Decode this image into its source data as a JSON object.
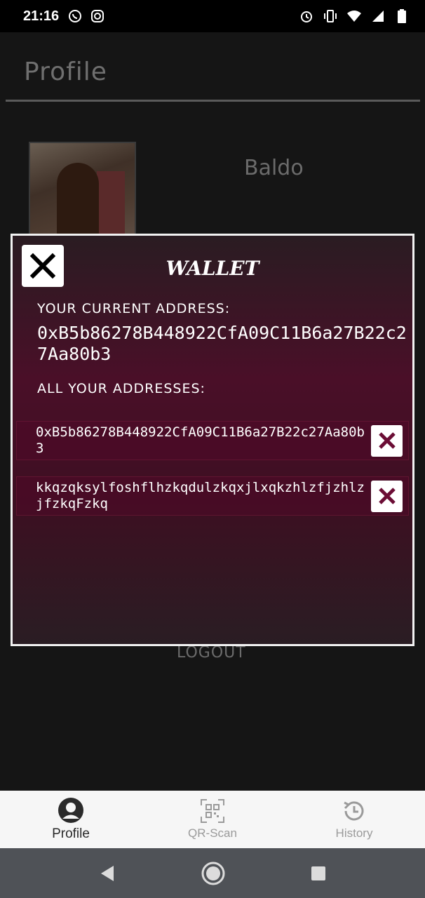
{
  "status_bar": {
    "time": "21:16",
    "left_icons": [
      "whatsapp-icon",
      "instagram-icon"
    ],
    "right_icons": [
      "alarm-icon",
      "vibrate-icon",
      "wifi-icon",
      "signal-icon",
      "battery-icon"
    ]
  },
  "page": {
    "title": "Profile",
    "user_name": "Baldo",
    "logout_label": "LOGOUT"
  },
  "wallet_modal": {
    "title": "WALLET",
    "current_address_label": "YOUR CURRENT ADDRESS:",
    "current_address": "0xB5b86278B448922CfA09C11B6a27B22c27Aa80b3",
    "all_addresses_label": "ALL YOUR ADDRESSES:",
    "addresses": [
      "0xB5b86278B448922CfA09C11B6a27B22c27Aa80b3",
      "kkqzqksylfoshflhzkqdulzkqxjlxqkzhlzfjzhlzjfzkqFzkq"
    ]
  },
  "bottom_nav": {
    "items": [
      {
        "label": "Profile",
        "icon": "account-circle-icon",
        "active": true
      },
      {
        "label": "QR-Scan",
        "icon": "qr-code-icon",
        "active": false
      },
      {
        "label": "History",
        "icon": "history-icon",
        "active": false
      }
    ]
  },
  "colors": {
    "modal_border": "#f2f2f2",
    "modal_accent": "#6b0d35",
    "background": "#141414"
  }
}
